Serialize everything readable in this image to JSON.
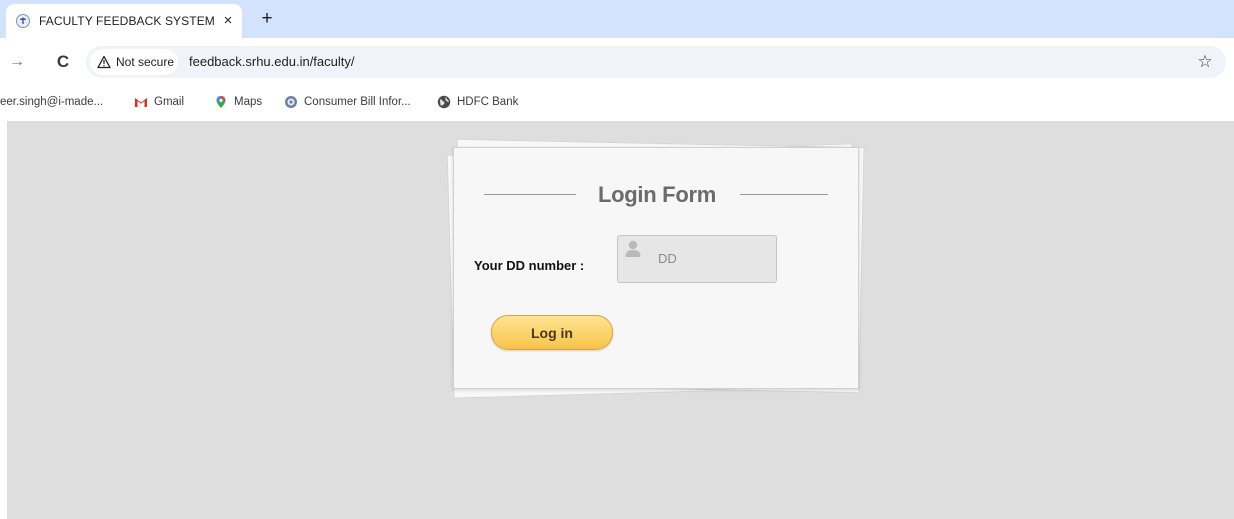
{
  "browser": {
    "tab": {
      "title": "FACULTY FEEDBACK SYSTEM",
      "close": "×"
    },
    "new_tab": "+",
    "toolbar": {
      "security_label": "Not secure",
      "url": "feedback.srhu.edu.in/faculty/"
    },
    "bookmarks": [
      {
        "label": "eer.singh@i-made...",
        "icon": "none"
      },
      {
        "label": "Gmail",
        "icon": "gmail-icon"
      },
      {
        "label": "Maps",
        "icon": "maps-icon"
      },
      {
        "label": "Consumer Bill Infor...",
        "icon": "globe-icon"
      },
      {
        "label": "HDFC Bank",
        "icon": "globe-icon"
      }
    ]
  },
  "login_form": {
    "title": "Login Form",
    "dd_label": "Your DD number :",
    "dd_placeholder": "DD",
    "dd_value": "",
    "submit_label": "Log in"
  },
  "colors": {
    "tabstrip": "#d3e3fd",
    "page_bg": "#dedede",
    "button_gradient_top": "#ffe493",
    "button_gradient_bottom": "#f7c44a"
  }
}
